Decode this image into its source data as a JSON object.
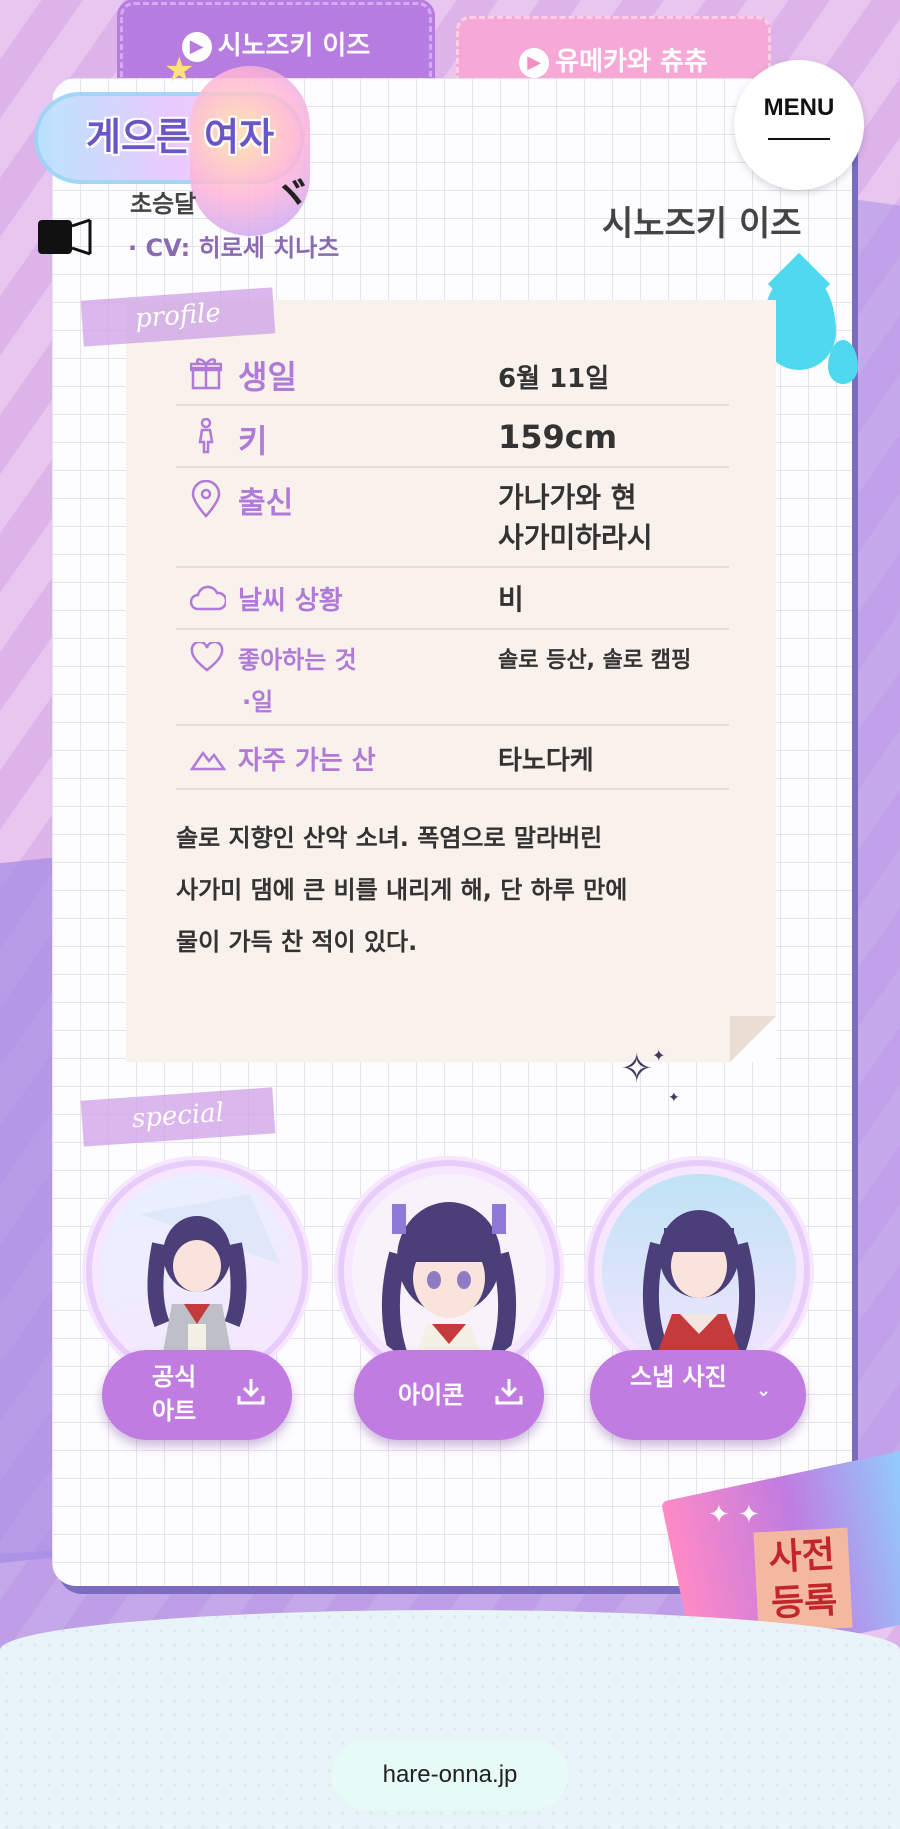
{
  "tabs": [
    {
      "label": "시노즈키 이즈",
      "active": true
    },
    {
      "label": "유메카와 츄츄",
      "active": false
    }
  ],
  "logo": {
    "title": "게으른 여자"
  },
  "menu": {
    "label": "MENU"
  },
  "character": {
    "role": "초승달",
    "cv": "· CV: 히로세 치나츠",
    "name": "시노즈키 이즈"
  },
  "profile": {
    "tape": "profile",
    "rows": [
      {
        "icon": "gift-icon",
        "label": "생일",
        "value": "6월 11일"
      },
      {
        "icon": "person-icon",
        "label": "키",
        "value": "159cm"
      },
      {
        "icon": "location-pin-icon",
        "label": "출신",
        "value_lines": [
          "가나가와 현",
          "사가미하라시"
        ]
      },
      {
        "icon": "cloud-icon",
        "label": "날씨 상황",
        "value": "비"
      },
      {
        "icon": "heart-icon",
        "label_lines": [
          "좋아하는 것",
          "·일"
        ],
        "value": "솔로 등산, 솔로 캠핑"
      },
      {
        "icon": "mountain-icon",
        "label": "자주 가는 산",
        "value": "타노다케"
      }
    ],
    "description": [
      "솔로 지향인 산악 소녀. 폭염으로 말라버린",
      "사가미 댐에 큰 비를 내리게 해, 단 하루 만에",
      "물이 가득 찬 적이 있다."
    ]
  },
  "special": {
    "tape": "special",
    "buttons": [
      {
        "label_lines": [
          "공식",
          "아트"
        ],
        "icon": "download-icon"
      },
      {
        "label": "아이콘",
        "icon": "download-icon"
      },
      {
        "label": "스냅 사진",
        "icon": "chevron-down-icon"
      }
    ]
  },
  "register": {
    "label_lines": [
      "사전",
      "등록"
    ]
  },
  "footer": {
    "site": "hare-onna.jp"
  },
  "colors": {
    "accent_purple": "#c07ce0",
    "tab_pink": "#f6a8d6",
    "drop_cyan": "#4fd9ef",
    "paper": "#f8f1ec"
  }
}
